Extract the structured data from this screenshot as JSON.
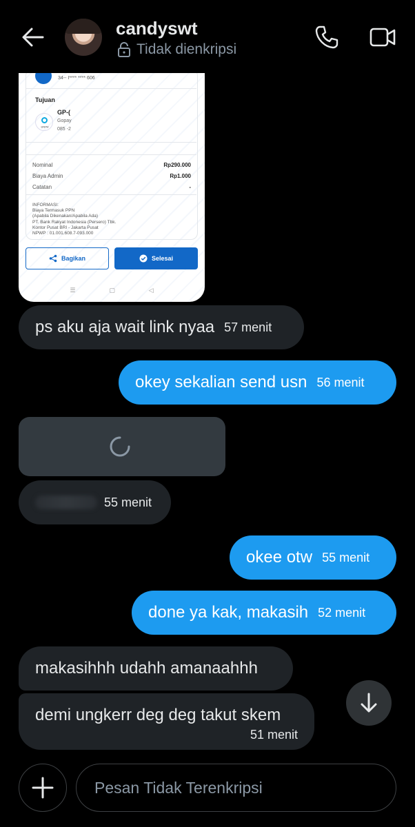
{
  "header": {
    "username": "candyswt",
    "encryption_status": "Tidak dienkripsi"
  },
  "receipt": {
    "account_masked": "34-- I**** **** 606",
    "tujuan_label": "Tujuan",
    "recipient_name": "GP-(",
    "recipient_bank": "Gopay",
    "recipient_number": "085 -2",
    "gopay_logo_text": "gopay",
    "rows": [
      {
        "label": "Nominal",
        "value": "Rp290.000"
      },
      {
        "label": "Biaya Admin",
        "value": "Rp1.000"
      },
      {
        "label": "Catatan",
        "value": "-"
      }
    ],
    "info_lines": [
      "INFORMASI:",
      "Biaya Termasuk PPN",
      "(Apabila Dikenakan/Apabila Ada)",
      "PT. Bank Rakyat Indonesia (Persero) Tbk.",
      "Kontor Pusat BRI - Jakarta Pusat",
      "NPWP : 01.001.608.7-093.000"
    ],
    "share_label": "Bagikan",
    "done_label": "Selesai"
  },
  "messages": [
    {
      "dir": "in",
      "text": "ps aku aja wait link nyaa",
      "time": "57 menit"
    },
    {
      "dir": "out",
      "text": "okey sekalian send usn",
      "time": "56 menit"
    },
    {
      "dir": "in",
      "text": "",
      "time": "55 menit"
    },
    {
      "dir": "out",
      "text": "okee otw",
      "time": "55 menit"
    },
    {
      "dir": "out",
      "text": "done ya kak, makasih",
      "time": "52 menit"
    },
    {
      "dir": "in",
      "text": "makasihhh udahh amanaahhh",
      "time": ""
    },
    {
      "dir": "in",
      "text": "demi ungkerr deg deg takut skem",
      "time": "51 menit"
    }
  ],
  "composer": {
    "placeholder": "Pesan Tidak Terenkripsi"
  },
  "colors": {
    "outgoing_bubble": "#1d9bf0",
    "incoming_bubble": "#1f2327",
    "background": "#000000"
  }
}
